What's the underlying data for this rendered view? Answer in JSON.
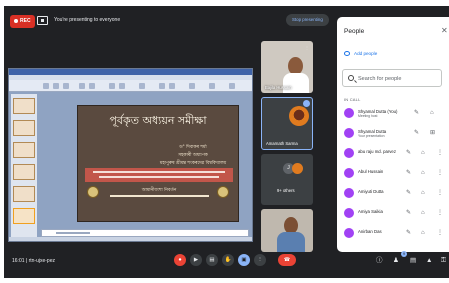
{
  "top_bar": {
    "rec_label": "REC",
    "presenting_text": "You're presenting to everyone",
    "stop_label": "Stop presenting"
  },
  "slide": {
    "title": "পূর্বকৃত অধ্যয়ন সমীক্ষা",
    "lines": [
      "ড° দিবাকৰ শৰ্মা",
      "সহকাৰী অধ্যাপক",
      "মহাপুৰুষ শ্ৰীমন্ত শংকৰদেৱ বিশ্ববিদ্যালয়"
    ],
    "footer_title": "আমানীবংশা নিবৰ্তন"
  },
  "tiles": [
    {
      "name": "Bajila Hussain"
    },
    {
      "name": "Amarnath Sarma"
    },
    {
      "name": "9+ others",
      "initial": "J"
    },
    {
      "name": ""
    }
  ],
  "people_panel": {
    "title": "People",
    "close_glyph": "✕",
    "add_people_label": "Add people",
    "search_placeholder": "Search for people",
    "in_call_label": "IN CALL",
    "participants": [
      {
        "name": "Shyamal Dutta (You)",
        "subtitle": "Meeting host",
        "avatar_color": "#a142f4"
      },
      {
        "name": "Shyamal Dutta",
        "subtitle": "Your presentation",
        "avatar_color": "#a142f4"
      },
      {
        "name": "abu raju md. parvez",
        "subtitle": "",
        "avatar_color": "#a142f4"
      },
      {
        "name": "Abul Hussain",
        "subtitle": "",
        "avatar_color": "#a142f4"
      },
      {
        "name": "Amiyuti Dutta",
        "subtitle": "",
        "avatar_color": "#a142f4"
      },
      {
        "name": "Amiya Saikia",
        "subtitle": "",
        "avatar_color": "#a142f4"
      },
      {
        "name": "Anirban Das",
        "subtitle": "",
        "avatar_color": "#a142f4"
      }
    ]
  },
  "bottom_bar": {
    "time_label": "16:01 | rtn-ujxe-pez",
    "controls": [
      "mic",
      "camera",
      "captions",
      "raise-hand",
      "present",
      "more",
      "end-call"
    ],
    "right_controls": [
      "info",
      "people",
      "chat",
      "activities",
      "host-controls"
    ],
    "people_badge": "9"
  },
  "colors": {
    "meet_background": "#202124",
    "record_red": "#d93025",
    "accent_blue": "#8ab4f8",
    "end_call_red": "#ea4335",
    "avatar_purple": "#a142f4"
  }
}
